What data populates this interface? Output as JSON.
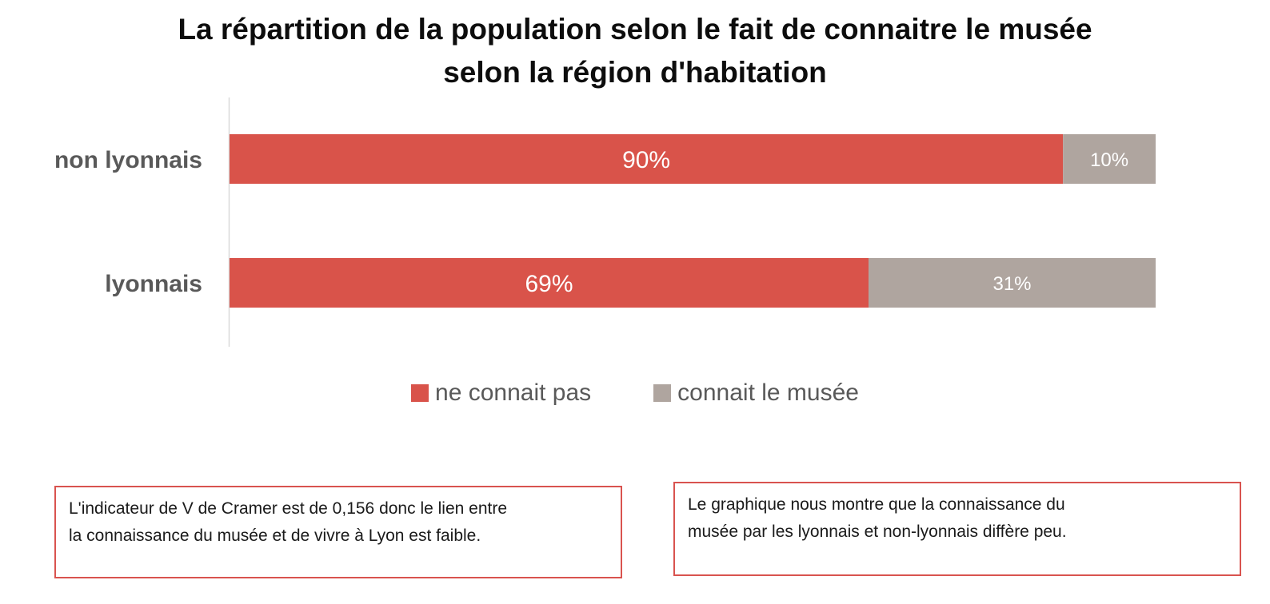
{
  "title_lines": [
    "La répartition de la population selon le fait de connaitre le musée",
    "selon la région d'habitation"
  ],
  "chart_data": {
    "type": "bar",
    "orientation": "horizontal",
    "stacked": true,
    "percent": true,
    "categories": [
      "non lyonnais",
      "lyonnais"
    ],
    "series": [
      {
        "name": "ne connait pas",
        "values": [
          90,
          69
        ],
        "labels": [
          "90%",
          "69%"
        ],
        "color": "#d9534a"
      },
      {
        "name": "connait le musée",
        "values": [
          10,
          31
        ],
        "labels": [
          "10%",
          "31%"
        ],
        "color": "#afa59f"
      }
    ],
    "xlim": [
      0,
      100
    ],
    "grid": false,
    "legend_position": "bottom"
  },
  "legend": {
    "items": [
      {
        "label": "ne connait pas",
        "color": "#d9534a"
      },
      {
        "label": "connait le musée",
        "color": "#afa59f"
      }
    ]
  },
  "notes": {
    "left": {
      "lines": [
        "L'indicateur de V de Cramer est de 0,156 donc le lien entre",
        "la connaissance du musée et de vivre à Lyon est faible."
      ]
    },
    "right": {
      "lines": [
        "Le graphique nous montre que la connaissance du",
        "musée par les lyonnais et non-lyonnais diffère peu."
      ]
    }
  }
}
